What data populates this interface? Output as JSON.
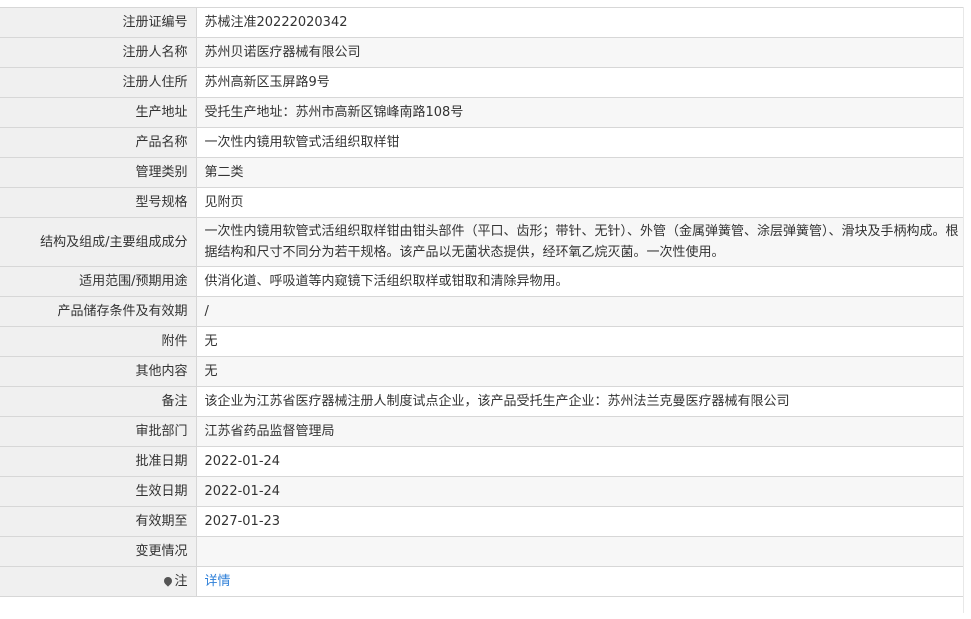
{
  "rows": [
    {
      "label": "注册证编号",
      "value": "苏械注准20222020342"
    },
    {
      "label": "注册人名称",
      "value": "苏州贝诺医疗器械有限公司"
    },
    {
      "label": "注册人住所",
      "value": "苏州高新区玉屏路9号"
    },
    {
      "label": "生产地址",
      "value": "受托生产地址：苏州市高新区锦峰南路108号"
    },
    {
      "label": "产品名称",
      "value": "一次性内镜用软管式活组织取样钳"
    },
    {
      "label": "管理类别",
      "value": "第二类"
    },
    {
      "label": "型号规格",
      "value": "见附页"
    },
    {
      "label": "结构及组成/主要组成成分",
      "value": "一次性内镜用软管式活组织取样钳由钳头部件（平口、齿形；带针、无针）、外管（金属弹簧管、涂层弹簧管）、滑块及手柄构成。根据结构和尺寸不同分为若干规格。该产品以无菌状态提供，经环氧乙烷灭菌。一次性使用。"
    },
    {
      "label": "适用范围/预期用途",
      "value": "供消化道、呼吸道等内窥镜下活组织取样或钳取和清除异物用。"
    },
    {
      "label": "产品储存条件及有效期",
      "value": "/"
    },
    {
      "label": "附件",
      "value": "无"
    },
    {
      "label": "其他内容",
      "value": "无"
    },
    {
      "label": "备注",
      "value": "该企业为江苏省医疗器械注册人制度试点企业，该产品受托生产企业：苏州法兰克曼医疗器械有限公司"
    },
    {
      "label": "审批部门",
      "value": "江苏省药品监督管理局"
    },
    {
      "label": "批准日期",
      "value": "2022-01-24"
    },
    {
      "label": "生效日期",
      "value": "2022-01-24"
    },
    {
      "label": "有效期至",
      "value": "2027-01-23"
    },
    {
      "label": "变更情况",
      "value": ""
    }
  ],
  "note_row": {
    "label": "注",
    "link": "详情",
    "icon": "pin-icon"
  },
  "colors": {
    "label_bg": "#f0f0f0",
    "border": "#d7d7d7",
    "link": "#2e7fd8",
    "text": "#333333"
  }
}
